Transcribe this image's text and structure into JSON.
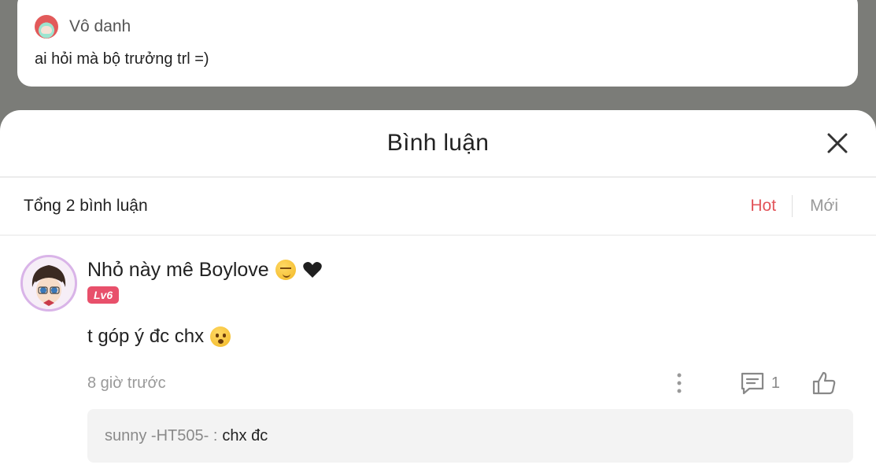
{
  "post": {
    "author": "Vô danh",
    "text": "ai hỏi mà bộ trưởng trl =)"
  },
  "sheet": {
    "title": "Bình luận",
    "total_label": "Tổng 2 bình luận",
    "sort_hot": "Hot",
    "sort_new": "Mới"
  },
  "comment": {
    "author": "Nhỏ này mê Boylove",
    "level_badge": "Lv6",
    "text": "t góp ý đc chx",
    "time": "8 giờ trước",
    "reply_count": "1",
    "reply": {
      "user": "sunny -HT505- :",
      "text": "chx đc"
    }
  },
  "colors": {
    "accent": "#e2545a",
    "badge": "#e8506b",
    "backdrop": "#7b7c78"
  },
  "icons": [
    "close-icon",
    "smirk-emoji-icon",
    "black-heart-icon",
    "crying-emoji-icon",
    "more-vertical-icon",
    "comment-icon",
    "thumbs-up-icon"
  ]
}
